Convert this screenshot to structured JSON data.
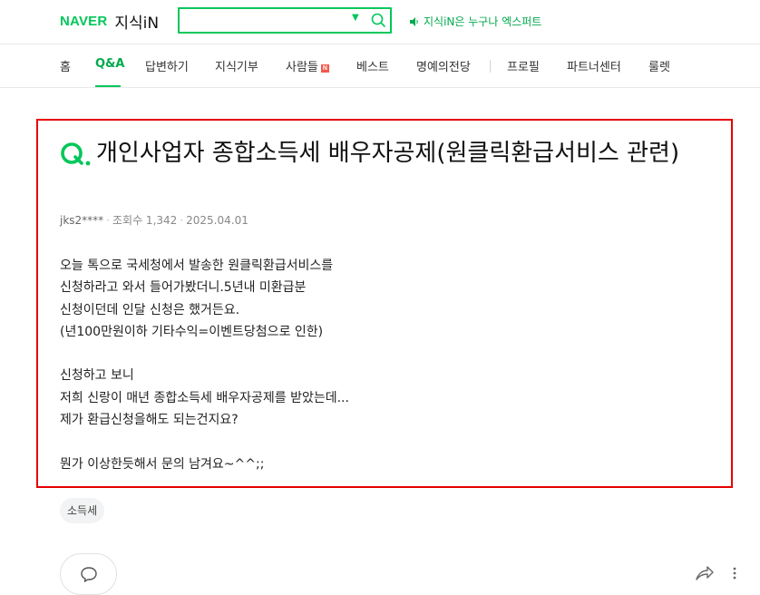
{
  "header": {
    "logo_brand": "NAVER",
    "logo_service": "지식iN",
    "search": {
      "value": "",
      "placeholder": ""
    },
    "promo_text": "지식iN은 누구나 엑스퍼트"
  },
  "nav": {
    "items": [
      {
        "label": "홈"
      },
      {
        "label": "Q&A"
      },
      {
        "label": "답변하기"
      },
      {
        "label": "지식기부"
      },
      {
        "label": "사람들"
      },
      {
        "label": "베스트"
      },
      {
        "label": "명예의전당"
      },
      {
        "label": "프로필"
      },
      {
        "label": "파트너센터"
      },
      {
        "label": "룰렛"
      }
    ],
    "new_badge": "N",
    "active": "Q&A"
  },
  "question": {
    "title": "개인사업자 종합소득세 배우자공제(원클릭환급서비스 관련)",
    "author": "jks2****",
    "views": "조회수 1,342",
    "date": "2025.04.01",
    "body": [
      "오늘 톡으로 국세청에서 발송한 원클릭환급서비스를",
      "신청하라고 와서 들어가봤더니.5년내 미환급분",
      "신청이던데 인달 신청은 했거든요.",
      "(년100만원이하 기타수익=이벤트당첨으로 인한)",
      "",
      "신청하고 보니",
      "저희 신랑이 매년 종합소득세 배우자공제를 받았는데...",
      "제가 환급신청을해도 되는건지요?",
      "",
      "뭔가 이상한듯해서 문의 남겨요~^^;;"
    ]
  },
  "tags": [
    "소득세"
  ],
  "colors": {
    "brand_green": "#03c75a",
    "highlight_border": "#e60000"
  },
  "icons": {
    "search": "search-icon",
    "speaker": "speaker-icon",
    "comment": "comment-icon",
    "share": "share-icon",
    "more": "more-vertical-icon"
  }
}
